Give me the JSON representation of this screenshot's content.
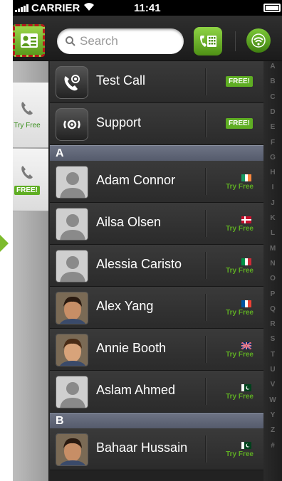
{
  "status": {
    "carrier": "CARRIER",
    "time": "11:41"
  },
  "search": {
    "placeholder": "Search"
  },
  "left_panel": {
    "try_free_label": "Try Free",
    "free_label": "FREE!"
  },
  "special_rows": [
    {
      "name": "Test Call",
      "badge": "FREE!"
    },
    {
      "name": "Support",
      "badge": "FREE!"
    }
  ],
  "sections": [
    {
      "letter": "A"
    },
    {
      "letter": "B"
    }
  ],
  "contacts": [
    {
      "name": "Adam Connor",
      "action": "Try Free",
      "flag": "ireland",
      "photo": false
    },
    {
      "name": "Ailsa Olsen",
      "action": "Try Free",
      "flag": "denmark",
      "photo": false
    },
    {
      "name": "Alessia Caristo",
      "action": "Try Free",
      "flag": "italy",
      "photo": false
    },
    {
      "name": "Alex Yang",
      "action": "Try Free",
      "flag": "france",
      "photo": true
    },
    {
      "name": "Annie Booth",
      "action": "Try Free",
      "flag": "uk",
      "photo": true
    },
    {
      "name": "Aslam Ahmed",
      "action": "Try Free",
      "flag": "pakistan",
      "photo": false
    },
    {
      "name": "Bahaar Hussain",
      "action": "Try Free",
      "flag": "pakistan",
      "photo": true
    }
  ],
  "index": [
    "A",
    "B",
    "C",
    "D",
    "E",
    "F",
    "G",
    "H",
    "I",
    "J",
    "K",
    "L",
    "M",
    "N",
    "O",
    "P",
    "Q",
    "R",
    "S",
    "T",
    "U",
    "V",
    "W",
    "Y",
    "Z",
    "#"
  ],
  "colors": {
    "accent_green": "#5fae23",
    "header_blue": "#6d7384"
  }
}
